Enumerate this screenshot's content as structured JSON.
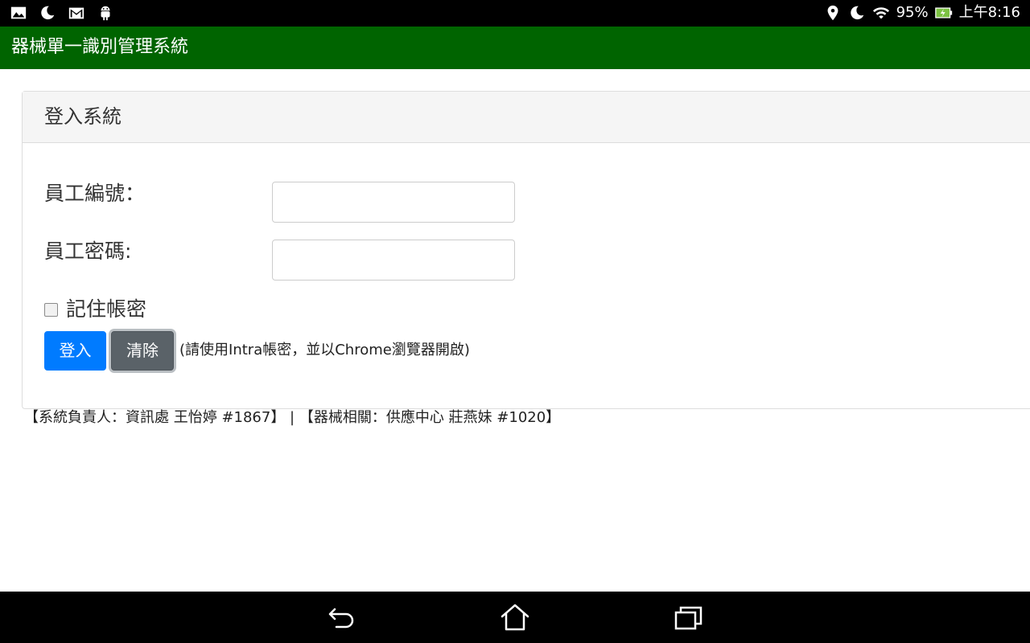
{
  "status_bar": {
    "left_icons": [
      "gallery-icon",
      "moon-icon",
      "gmail-icon",
      "android-icon"
    ],
    "right_icons": [
      "location-icon",
      "moon-icon",
      "wifi-icon",
      "battery-charging-icon"
    ],
    "battery": "95%",
    "time": "上午8:16"
  },
  "app": {
    "title": "器械單一識別管理系統",
    "brand_color": "#006400"
  },
  "login_panel": {
    "title": "登入系統",
    "employee_id_label": "員工編號：",
    "employee_id_value": "",
    "password_label": "員工密碼:",
    "password_value": "",
    "remember_label": "記住帳密",
    "remember_checked": false,
    "login_button": "登入",
    "clear_button": "清除",
    "hint": "(請使用Intra帳密，並以Chrome瀏覽器開啟)"
  },
  "footer": {
    "contact": "【系統負責人：資訊處 王怡婷 #1867】 | 【器械相關：供應中心 莊燕妹 #1020】"
  },
  "nav_bar": {
    "buttons": [
      "back-icon",
      "home-icon",
      "recent-apps-icon"
    ]
  }
}
